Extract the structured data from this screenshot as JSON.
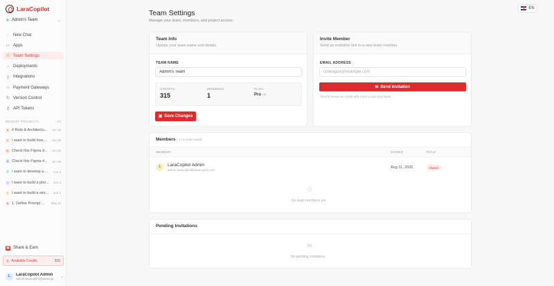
{
  "app": {
    "logo_text": "LaraCopilot",
    "team_name": "Admin's Team",
    "team_initial": "A"
  },
  "nav": [
    {
      "label": "New Chat",
      "icon": "chat-icon",
      "glyph": "◌"
    },
    {
      "label": "Apps",
      "icon": "apps-icon",
      "glyph": "▭"
    },
    {
      "label": "Team Settings",
      "icon": "team-icon",
      "glyph": "⚇",
      "active": true
    },
    {
      "label": "Deployments",
      "icon": "deploy-icon",
      "glyph": "→"
    },
    {
      "label": "Integrations",
      "icon": "integrations-icon",
      "glyph": "▯"
    },
    {
      "label": "Payment Gateways",
      "icon": "payment-icon",
      "glyph": "▭"
    },
    {
      "label": "Version Control",
      "icon": "git-icon",
      "glyph": "↻"
    },
    {
      "label": "API Tokens",
      "icon": "key-icon",
      "glyph": "⚷"
    }
  ],
  "recent": {
    "heading": "RECENT PROJECTS",
    "all_label": "All",
    "items": [
      {
        "initial": "#",
        "label": "# Role & Architectu...",
        "date": "Jun 16",
        "bg": "#fde6e6",
        "fg": "#d93b3b"
      },
      {
        "initial": "I",
        "label": "I want to build inve...",
        "date": "Jun 25",
        "bg": "#fde6e6",
        "fg": "#d93b3b"
      },
      {
        "initial": "C",
        "label": "Check this Figma d...",
        "date": "Jun 25",
        "bg": "#fde6e6",
        "fg": "#d93b3b"
      },
      {
        "initial": "C",
        "label": "Check this Figma d...",
        "date": "Jun 16",
        "bg": "#ece6fd",
        "fg": "#7a4fd9"
      },
      {
        "initial": "I",
        "label": "I want to develop a ...",
        "date": "Jun 2",
        "bg": "#e4f6e8",
        "fg": "#2e8a46"
      },
      {
        "initial": "I",
        "label": "I want to build a pho...",
        "date": "Jun 2",
        "bg": "#e6ecfd",
        "fg": "#4a6fd1"
      },
      {
        "initial": "I",
        "label": "I want to build a sim...",
        "date": "Jun 1",
        "bg": "#fdf3d6",
        "fg": "#b07a00"
      },
      {
        "initial": "1",
        "label": "1. Define Prompt ...",
        "date": "May 11",
        "bg": "#fde6e6",
        "fg": "#d93b3b"
      }
    ]
  },
  "sidebar_bottom": {
    "share_label": "Share & Earn",
    "credits_label": "Available Credits",
    "credits_value": "315",
    "user_name": "LaraCopilot Admin",
    "user_email": "admin.laracopilot@laracopi...",
    "user_initial": "L"
  },
  "lang": {
    "code": "EN"
  },
  "page": {
    "title": "Team Settings",
    "subtitle": "Manage your team, members, and project access."
  },
  "team_info": {
    "title": "Team Info",
    "desc": "Update your team name and details.",
    "name_label": "TEAM NAME",
    "name_value": "Admin's Team",
    "credits_label": "CREDITS",
    "credits_value": "315",
    "members_label": "MEMBERS",
    "members_value": "1",
    "plan_label": "PLAN",
    "plan_value": "Pro",
    "plan_suffix": "V5",
    "save_label": "Save Changes"
  },
  "invite": {
    "title": "Invite Member",
    "desc": "Send an invitation link to a new team member.",
    "email_label": "EMAIL ADDRESS",
    "email_placeholder": "colleague@example.com",
    "send_label": "Send Invitation",
    "hint": "They'll receive an email with a link to join your team."
  },
  "members": {
    "title": "Members",
    "count_note": "( 1 / 5 seats used)",
    "col_member": "MEMBER",
    "col_joined": "JOINED",
    "col_role": "ROLE",
    "rows": [
      {
        "initial": "L",
        "name": "LaraCopilot Admin",
        "email": "admin.laracopilot@laracopilot.com",
        "joined": "Aug 11, 2026",
        "role": "Owner"
      }
    ],
    "empty_text": "No team members yet"
  },
  "pending": {
    "title": "Pending Invitations",
    "empty_text": "No pending invitations"
  },
  "colors": {
    "accent": "#e02b2b"
  }
}
